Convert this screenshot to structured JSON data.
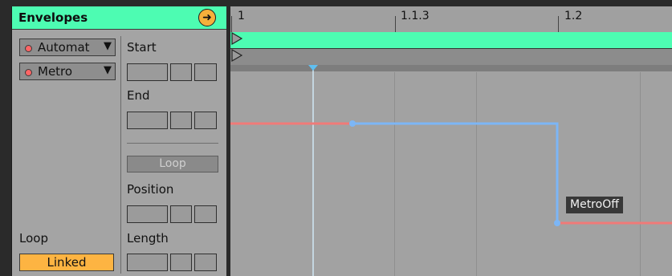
{
  "panel": {
    "title": "Envelopes",
    "arrow_icon": "arrow-right-icon",
    "device_chooser": {
      "value": "Automat",
      "arrow": "▼"
    },
    "control_chooser": {
      "value": "Metro",
      "arrow": "▼"
    },
    "start_label": "Start",
    "end_label": "End",
    "loop_button": "Loop",
    "position_label": "Position",
    "length_label": "Length",
    "loop_label": "Loop",
    "linked_button": "Linked"
  },
  "ruler": {
    "ticks": [
      "1",
      "1.1.3",
      "1.2"
    ]
  },
  "envelope": {
    "tooltip": "MetroOff",
    "colors": {
      "inactive": "#f07a78",
      "active": "#7cb6f6"
    }
  },
  "colors": {
    "accent": "#4dfcb2",
    "button_orange": "#fdb442",
    "record_dot": "#ff6565"
  }
}
